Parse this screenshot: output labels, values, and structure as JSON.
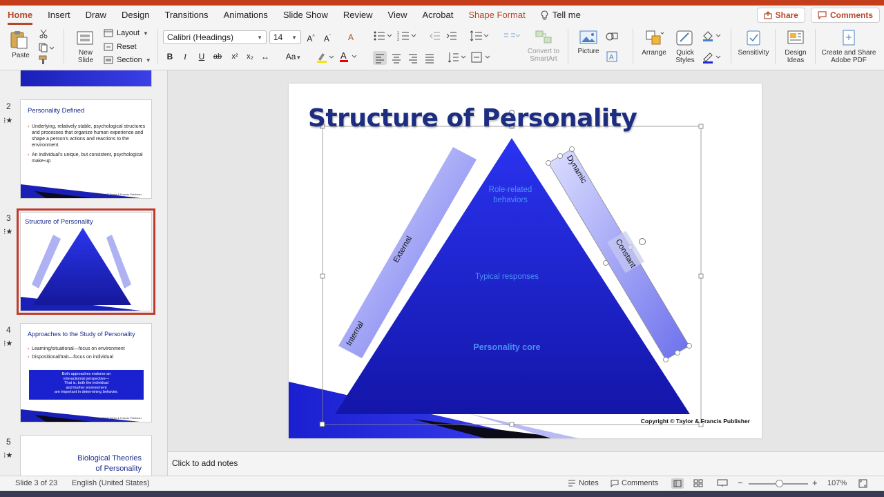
{
  "tabs": [
    {
      "label": "Home",
      "active": true
    },
    {
      "label": "Insert"
    },
    {
      "label": "Draw"
    },
    {
      "label": "Design"
    },
    {
      "label": "Transitions"
    },
    {
      "label": "Animations"
    },
    {
      "label": "Slide Show"
    },
    {
      "label": "Review"
    },
    {
      "label": "View"
    },
    {
      "label": "Acrobat"
    },
    {
      "label": "Shape Format",
      "contextual": true
    }
  ],
  "tell_me": "Tell me",
  "share_label": "Share",
  "comments_label": "Comments",
  "ribbon": {
    "paste": "Paste",
    "new_slide": "New Slide",
    "layout": "Layout",
    "reset": "Reset",
    "section": "Section",
    "font_name": "Calibri (Headings)",
    "font_size": "14",
    "convert_smartart": "Convert to SmartArt",
    "picture": "Picture",
    "arrange": "Arrange",
    "quick_styles": "Quick Styles",
    "sensitivity": "Sensitivity",
    "design_ideas": "Design Ideas",
    "create_share_pdf": "Create and Share Adobe PDF"
  },
  "thumbnails": [
    {
      "number": "2",
      "title": "Personality Defined",
      "bullets": [
        "Underlying, relatively stable, psychological structures and processes that organize human experience and shape a person’s actions and reactions to the environment",
        "An individual’s unique, but consistent, psychological make-up"
      ]
    },
    {
      "number": "3",
      "title": "Structure of Personality"
    },
    {
      "number": "4",
      "title": "Approaches to the Study of Personality",
      "bullets": [
        "Learning/situational—focus on environment",
        "Dispositional/trait—focus on individual"
      ],
      "box_lines": [
        "Both approaches endorse an",
        "interactionist perspective—",
        "That is, both the individual",
        "and his/her environment",
        "are important in determining behavior."
      ]
    },
    {
      "number": "5",
      "title_lines": [
        "Biological Theories",
        "of Personality"
      ]
    }
  ],
  "slide": {
    "title": "Structure of Personality",
    "top_label": [
      "Role-related",
      "behaviors"
    ],
    "middle_label": "Typical responses",
    "bottom_label": "Personality core",
    "left_bar_top": "External",
    "left_bar_bottom": "Internal",
    "right_bar_top": "Dynamic",
    "right_bar_bottom": "Constant",
    "copyright": "Copyright © Taylor & Francis  Publisher"
  },
  "notes_placeholder": "Click to add notes",
  "status": {
    "slide_of": "Slide 3 of 23",
    "language": "English (United States)",
    "notes": "Notes",
    "comments": "Comments",
    "zoom": "107%"
  },
  "colors": {
    "accent": "#b7472a",
    "title_blue": "#1c2d82",
    "triangle_blue": "#1c26d8",
    "selection_red": "#c0392b"
  }
}
